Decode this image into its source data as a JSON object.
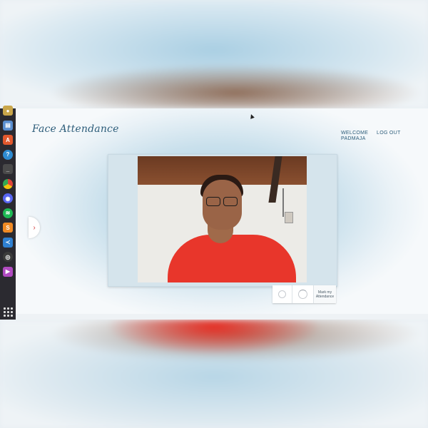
{
  "app": {
    "brand": "Face Attendance",
    "welcome_line1": "WELCOME",
    "welcome_line2": "PADMAJA",
    "logout_label": "LOG OUT",
    "side_arrow_glyph": "›",
    "mark_attendance_line1": "Mark my",
    "mark_attendance_line2": "Attendance"
  },
  "dock": {
    "icons": [
      {
        "name": "camera-app-icon",
        "color": "#c9a64a"
      },
      {
        "name": "files-icon",
        "color": "#5b8fd0"
      },
      {
        "name": "software-store-icon",
        "color": "#e2582d"
      },
      {
        "name": "help-icon",
        "color": "#2e8bd1"
      },
      {
        "name": "terminal-icon",
        "color": "#4a4a4a"
      },
      {
        "name": "chrome-icon",
        "color": "#e0453a"
      },
      {
        "name": "discord-icon",
        "color": "#5865f2"
      },
      {
        "name": "spotify-icon",
        "color": "#1db954"
      },
      {
        "name": "sublime-text-icon",
        "color": "#f08a24"
      },
      {
        "name": "vscode-icon",
        "color": "#2f80d1"
      },
      {
        "name": "obs-icon",
        "color": "#3b3b3b"
      },
      {
        "name": "video-player-icon",
        "color": "#b04ac0"
      }
    ]
  }
}
